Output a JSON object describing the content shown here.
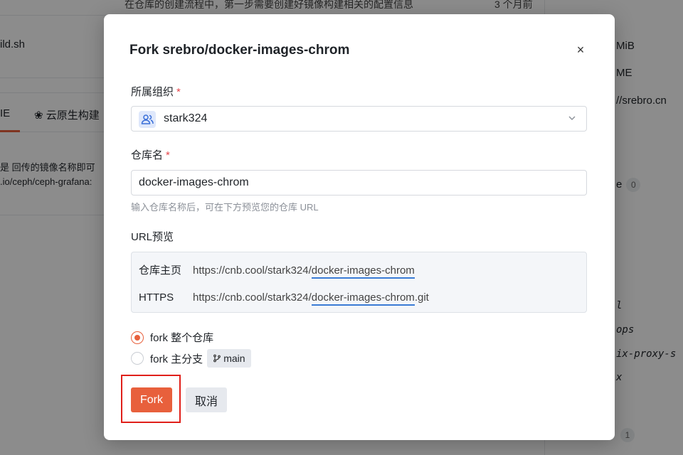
{
  "background": {
    "row1_text": "在仓库的创建流程中，第一步需要创建好镜像构建相关的配置信息",
    "row1_right": "3 个月前",
    "row2_text": "ild.sh",
    "tab_readme": "IE",
    "tab_cloud": "云原生构建",
    "line1": "是 回传的镜像名称即可",
    "line2": ".io/ceph/ceph-grafana:",
    "side": {
      "size": "MiB",
      "license": "ME",
      "url": "//srebro.cn",
      "e_label": "e",
      "e_count": "0",
      "mono1": "l",
      "mono2": "ops",
      "mono3": "ix-proxy-s",
      "mono4": "x",
      "bottom_count": "1"
    }
  },
  "modal": {
    "title": "Fork srebro/docker-images-chrom",
    "close_label": "×",
    "org_label": "所属组织",
    "required_mark": "*",
    "org_value": "stark324",
    "repo_label": "仓库名",
    "repo_value": "docker-images-chrom",
    "repo_hint": "输入仓库名称后，可在下方预览您的仓库 URL",
    "url_preview_label": "URL预览",
    "preview": {
      "home_key": "仓库主页",
      "home_prefix": "https://cnb.cool/stark324/",
      "home_name": "docker-images-chrom",
      "https_key": "HTTPS",
      "https_prefix": "https://cnb.cool/stark324/",
      "https_name": "docker-images-chrom",
      "https_suffix": ".git"
    },
    "option_all": "fork 整个仓库",
    "option_main": "fork 主分支",
    "branch": "main",
    "fork_button": "Fork",
    "cancel_button": "取消"
  },
  "colors": {
    "accent": "#e8603c",
    "highlight": "#e0201a",
    "link_underline": "#3a7bd5"
  }
}
